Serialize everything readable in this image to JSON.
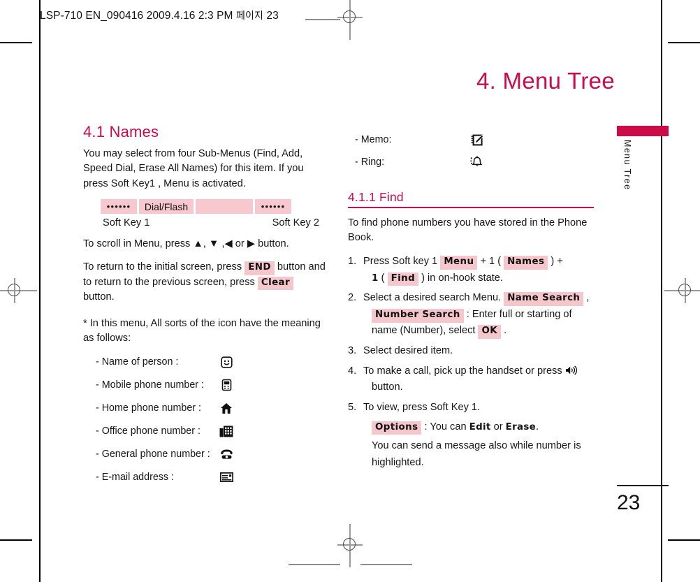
{
  "print_slug": {
    "text": "LSP-710 EN_090416  2009.4.16 2:3 PM",
    "korean": "페이지",
    "page": "23"
  },
  "header": {
    "title": "4. Menu Tree"
  },
  "side_tab": {
    "label": "Menu Tree"
  },
  "page_number": "23",
  "colors": {
    "accent": "#cc0b49",
    "highlight": "#f6c6cd",
    "text": "#151515"
  },
  "left_column": {
    "section_heading": "4.1 Names",
    "intro": "You may select from four Sub-Menus (Find, Add, Speed Dial, Erase All Names) for this item. If you press Soft Key1 , Menu is activated.",
    "keystrip": [
      {
        "type": "dots",
        "label": "••••••"
      },
      {
        "type": "label",
        "label": "Dial/Flash"
      },
      {
        "type": "blank",
        "label": ""
      },
      {
        "type": "dots",
        "label": "••••••"
      }
    ],
    "softkey_left": "Soft Key 1",
    "softkey_right": "Soft Key 2",
    "scroll_text_before": "To scroll in Menu, press ",
    "scroll_arrows": [
      "▲",
      "▼",
      "◀",
      "▶"
    ],
    "scroll_text_after": " button.",
    "return_text_1": "To return to the initial screen, press",
    "return_key_end": "END",
    "return_text_2": "button and to return to the previous screen, press",
    "return_key_clear": "Clear",
    "return_text_3": "button.",
    "note": "* In this menu, All sorts of the icon have the meaning as follows:",
    "icon_list": [
      {
        "label": "- Name of person :",
        "icon": "smiley-face-icon"
      },
      {
        "label": "- Mobile phone number :",
        "icon": "mobile-phone-icon"
      },
      {
        "label": "- Home phone number :",
        "icon": "house-icon"
      },
      {
        "label": "- Office phone number :",
        "icon": "office-building-icon"
      },
      {
        "label": "- General phone number :",
        "icon": "telephone-icon"
      },
      {
        "label": "- E-mail address :",
        "icon": "envelope-card-icon"
      }
    ]
  },
  "right_column": {
    "icon_list": [
      {
        "label": "- Memo:",
        "icon": "notepad-pencil-icon"
      },
      {
        "label": "- Ring:",
        "icon": "ringing-bell-icon"
      }
    ],
    "subsection_heading": "4.1.1 Find",
    "intro": "To find phone numbers you have stored in the Phone Book.",
    "steps": [
      {
        "num": "1.",
        "parts": [
          {
            "t": "text",
            "v": "Press Soft key 1 "
          },
          {
            "t": "chip",
            "v": "Menu"
          },
          {
            "t": "text",
            "v": " + 1 ( "
          },
          {
            "t": "chip",
            "v": "Names"
          },
          {
            "t": "text",
            "v": " ) +"
          },
          {
            "t": "break"
          },
          {
            "t": "bold",
            "v": "1"
          },
          {
            "t": "text",
            "v": " ( "
          },
          {
            "t": "chip",
            "v": "Find"
          },
          {
            "t": "text",
            "v": " ) in on-hook state."
          }
        ]
      },
      {
        "num": "2.",
        "parts": [
          {
            "t": "text",
            "v": "Select a desired search Menu. "
          },
          {
            "t": "chip",
            "v": "Name Search"
          },
          {
            "t": "text",
            "v": " ,"
          },
          {
            "t": "break"
          },
          {
            "t": "chip",
            "v": "Number Search"
          },
          {
            "t": "text",
            "v": " : Enter full or starting of"
          },
          {
            "t": "break"
          },
          {
            "t": "text",
            "v": "name (Number), select "
          },
          {
            "t": "chip",
            "v": "OK"
          },
          {
            "t": "text",
            "v": " ."
          }
        ]
      },
      {
        "num": "3.",
        "parts": [
          {
            "t": "text",
            "v": "Select desired item."
          }
        ]
      },
      {
        "num": "4.",
        "parts": [
          {
            "t": "text",
            "v": "To make a call, pick up the handset or press "
          },
          {
            "t": "icon",
            "v": "speaker-icon"
          },
          {
            "t": "break"
          },
          {
            "t": "text",
            "v": "button."
          }
        ]
      },
      {
        "num": "5.",
        "parts": [
          {
            "t": "text",
            "v": "To view, press Soft Key 1."
          },
          {
            "t": "break"
          },
          {
            "t": "chip",
            "v": "Options"
          },
          {
            "t": "text",
            "v": " : You can "
          },
          {
            "t": "bold",
            "v": "Edit"
          },
          {
            "t": "text",
            "v": " or "
          },
          {
            "t": "bold",
            "v": "Erase"
          },
          {
            "t": "text",
            "v": "."
          },
          {
            "t": "break"
          },
          {
            "t": "text",
            "v": "You can send a message also while number is"
          },
          {
            "t": "break"
          },
          {
            "t": "text",
            "v": "highlighted."
          }
        ]
      }
    ]
  }
}
